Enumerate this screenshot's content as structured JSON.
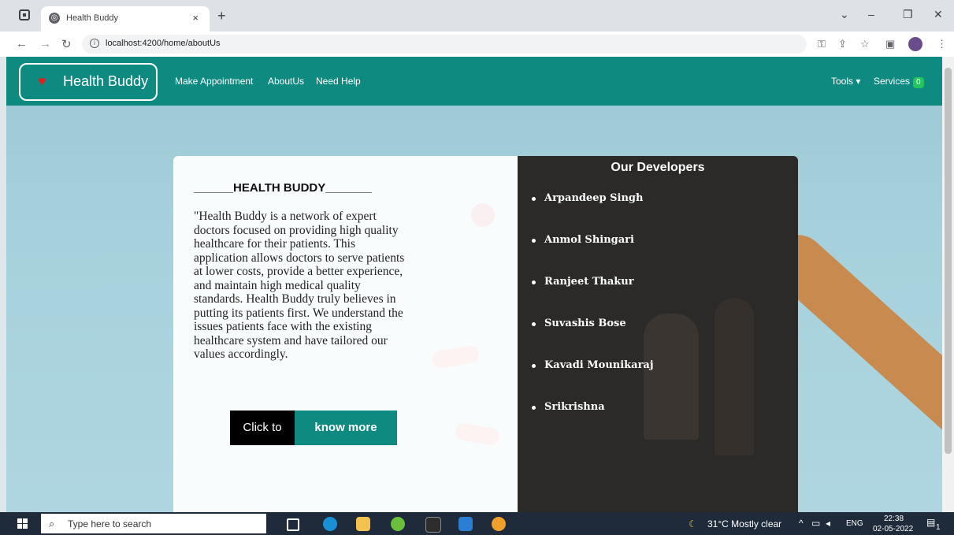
{
  "browser": {
    "tab_title": "Health Buddy",
    "tab_close": "×",
    "new_tab": "+",
    "url": "localhost:4200/home/aboutUs",
    "minimize": "–",
    "restore": "❐",
    "close": "✕",
    "chevron": "⌄"
  },
  "navbar": {
    "brand": "Health Buddy",
    "links": [
      "Make Appointment",
      "AboutUs",
      "Need Help"
    ],
    "tools": "Tools ▾",
    "services": "Services",
    "services_badge": "0"
  },
  "about": {
    "title": "______HEALTH BUDDY_______",
    "text": "\"Health Buddy is a network of expert doctors focused on providing high quality healthcare for their patients. This application allows doctors to serve patients at lower costs, provide a better experience, and maintain high medical quality standards. Health Buddy truly believes in putting its patients first. We understand the issues patients face with the existing healthcare system and have tailored our values accordingly.",
    "button_left": "Click to",
    "button_right": "know more"
  },
  "developers": {
    "title": "Our Developers",
    "names": [
      "Arpandeep Singh",
      "Anmol Shingari",
      "Ranjeet Thakur",
      "Suvashis Bose",
      "Kavadi Mounikaraj",
      "Srikrishna"
    ]
  },
  "taskbar": {
    "search_placeholder": "Type here to search",
    "weather": "31°C  Mostly clear",
    "lang": "ENG",
    "time": "22:38",
    "date": "02-05-2022",
    "notification_count": "1"
  },
  "colors": {
    "navbar": "#0e8a80",
    "dev_panel": "#2b2a28",
    "taskbar": "#1f2b3a"
  }
}
